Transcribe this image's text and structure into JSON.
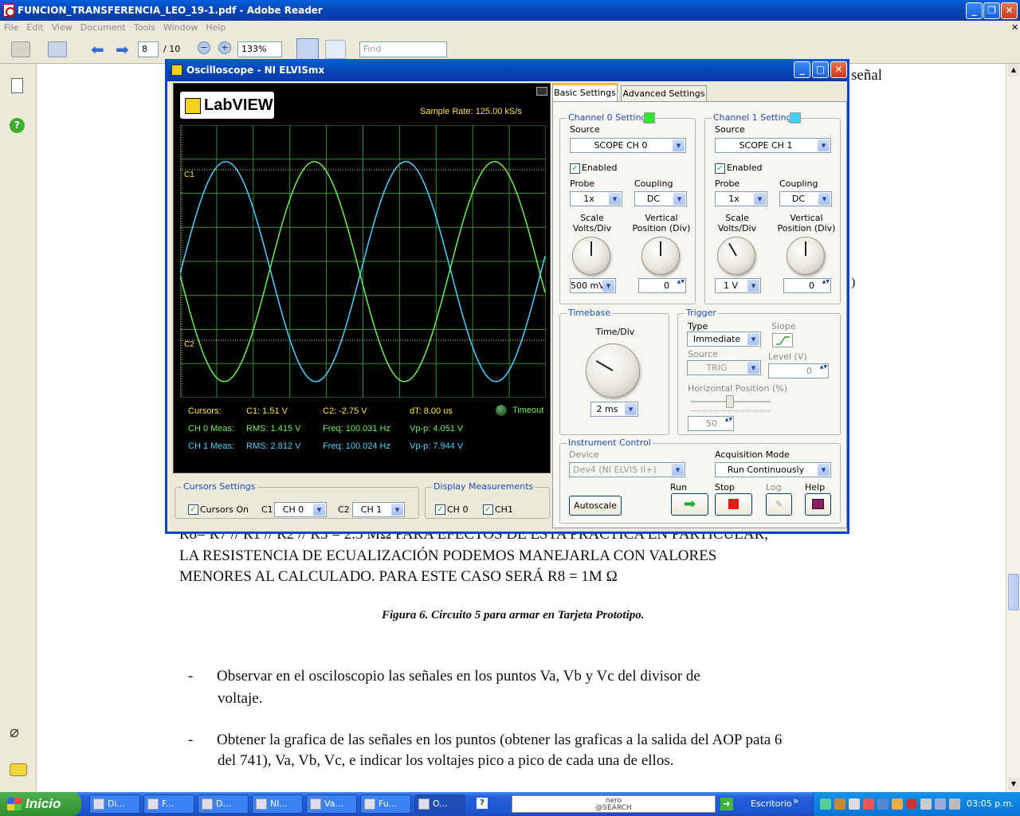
{
  "reader": {
    "title": "FUNCION_TRANSFERENCIA_LEO_19-1.pdf - Adobe Reader",
    "menus": [
      "File",
      "Edit",
      "View",
      "Document",
      "Tools",
      "Window",
      "Help"
    ],
    "page_current": "8",
    "page_total": "/ 10",
    "zoom": "133%",
    "find_placeholder": "Find"
  },
  "document": {
    "fragment_right_top": "señal",
    "fragment_right_mid": ")",
    "line1": "R8= R7 // R1 // R2 // R3 = 2.5 MΩ PARA EFECTOS DE ESTA PRÁCTICA EN PARTICULAR,",
    "line2": "LA RESISTENCIA DE ECUALIZACIÓN PODEMOS MANEJARLA CON VALORES",
    "line3": "MENORES AL CALCULADO. PARA ESTE CASO SERÁ R8 = 1M Ω",
    "caption": "Figura 6. Circuito 5 para armar en Tarjeta Prototipo.",
    "bullet_char": "-",
    "bullet1_a": "Observar  en  el  osciloscopio  las  señales  en  los  puntos  Va,  Vb  y  Vc  del  divisor  de",
    "bullet1_b": "voltaje.",
    "bullet2_a": "Obtener la grafica de las señales en los puntos (obtener las graficas a la salida del AOP pata 6",
    "bullet2_b": "del 741), Va, Vb, Vc,  e indicar los voltajes pico a pico de cada una de ellos."
  },
  "osc": {
    "title": "Oscilloscope - NI ELVISmx",
    "logo": "LabVIEW",
    "sample_rate": "Sample Rate:   125.00 kS/s",
    "c1_marker": "C1",
    "c2_marker": "C2",
    "timeout": "Timeout",
    "meas": {
      "cursors_label": "Cursors:",
      "c1": "C1: 1.51 V",
      "c2": "C2:   -2.75 V",
      "dt": "dT:   8.00 us",
      "ch0_label": "CH 0 Meas:",
      "ch0_rms": "RMS:  1.415 V",
      "ch0_freq": "Freq:  100.031 Hz",
      "ch0_vpp": "Vp-p:  4.051 V",
      "ch1_label": "CH 1 Meas:",
      "ch1_rms": "RMS:  2.812 V",
      "ch1_freq": "Freq:  100.024 Hz",
      "ch1_vpp": "Vp-p:  7.944 V"
    },
    "cursors_settings": {
      "title": "Cursors Settings",
      "cursors_on": "Cursors On",
      "c1_label": "C1",
      "c1_value": "CH 0",
      "c2_label": "C2",
      "c2_value": "CH 1"
    },
    "display_measurements": {
      "title": "Display Measurements",
      "ch0": "CH 0",
      "ch1": "CH1"
    },
    "tabs": {
      "basic": "Basic Settings",
      "advanced": "Advanced Settings"
    },
    "ch0": {
      "title": "Channel 0 Settings",
      "color": "#2ee82e",
      "source_label": "Source",
      "source": "SCOPE CH 0",
      "enabled": "Enabled",
      "probe_label": "Probe",
      "probe": "1x",
      "coupling_label": "Coupling",
      "coupling": "DC",
      "scale_label": "Scale\nVolts/Div",
      "vpos_label": "Vertical\nPosition (Div)",
      "scale": "500 mV",
      "vpos": "0"
    },
    "ch1": {
      "title": "Channel 1 Settings",
      "color": "#3ed3f5",
      "source_label": "Source",
      "source": "SCOPE CH 1",
      "enabled": "Enabled",
      "probe_label": "Probe",
      "probe": "1x",
      "coupling_label": "Coupling",
      "coupling": "DC",
      "scale_label": "Scale\nVolts/Div",
      "vpos_label": "Vertical\nPosition (Div)",
      "scale": "1 V",
      "vpos": "0"
    },
    "timebase": {
      "title": "Timebase",
      "label": "Time/Div",
      "value": "2 ms"
    },
    "trigger": {
      "title": "Trigger",
      "type_label": "Type",
      "type": "Immediate",
      "slope_label": "Slope",
      "source_label": "Source",
      "source": "TRIG",
      "level_label": "Level (V)",
      "level": "0",
      "hpos_label": "Horizontal Position (%)",
      "hpos": "50"
    },
    "instrument": {
      "title": "Instrument Control",
      "device_label": "Device",
      "device": "Dev4 (NI ELVIS II+)",
      "acq_label": "Acquisition Mode",
      "acq": "Run Continuously",
      "autoscale": "Autoscale",
      "run": "Run",
      "stop": "Stop",
      "log": "Log",
      "help": "Help"
    }
  },
  "taskbar": {
    "start": "Inicio",
    "tasks": [
      "Di...",
      "F...",
      "D...",
      "NI...",
      "Va...",
      "Fu...",
      "O..."
    ],
    "help_btn": "?",
    "search_brand": "nero\n@SEARCH",
    "desktop": "Escritorio",
    "clock": "03:05 p.m."
  }
}
